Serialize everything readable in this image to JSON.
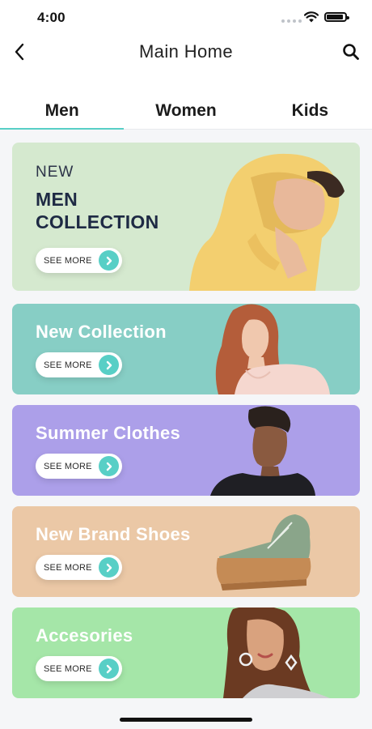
{
  "status_bar": {
    "time": "4:00"
  },
  "nav": {
    "title": "Main Home",
    "back_icon": "chevron-left-icon",
    "search_icon": "search-icon"
  },
  "tabs": [
    {
      "label": "Men",
      "active": true
    },
    {
      "label": "Women",
      "active": false
    },
    {
      "label": "Kids",
      "active": false
    }
  ],
  "hero": {
    "kicker": "NEW",
    "title_line1": "MEN",
    "title_line2": "COLLECTION",
    "button": "SEE MORE",
    "bg": "#d5e9cf"
  },
  "banners": [
    {
      "label": "New Collection",
      "button": "SEE MORE",
      "bg": "#87cec5"
    },
    {
      "label": "Summer Clothes",
      "button": "SEE MORE",
      "bg": "#ac9fe9"
    },
    {
      "label": "New Brand Shoes",
      "button": "SEE MORE",
      "bg": "#ebc8a6"
    },
    {
      "label": "Accesories",
      "button": "SEE MORE",
      "bg": "#a5e6a8"
    }
  ],
  "accent_color": "#58cfc6"
}
